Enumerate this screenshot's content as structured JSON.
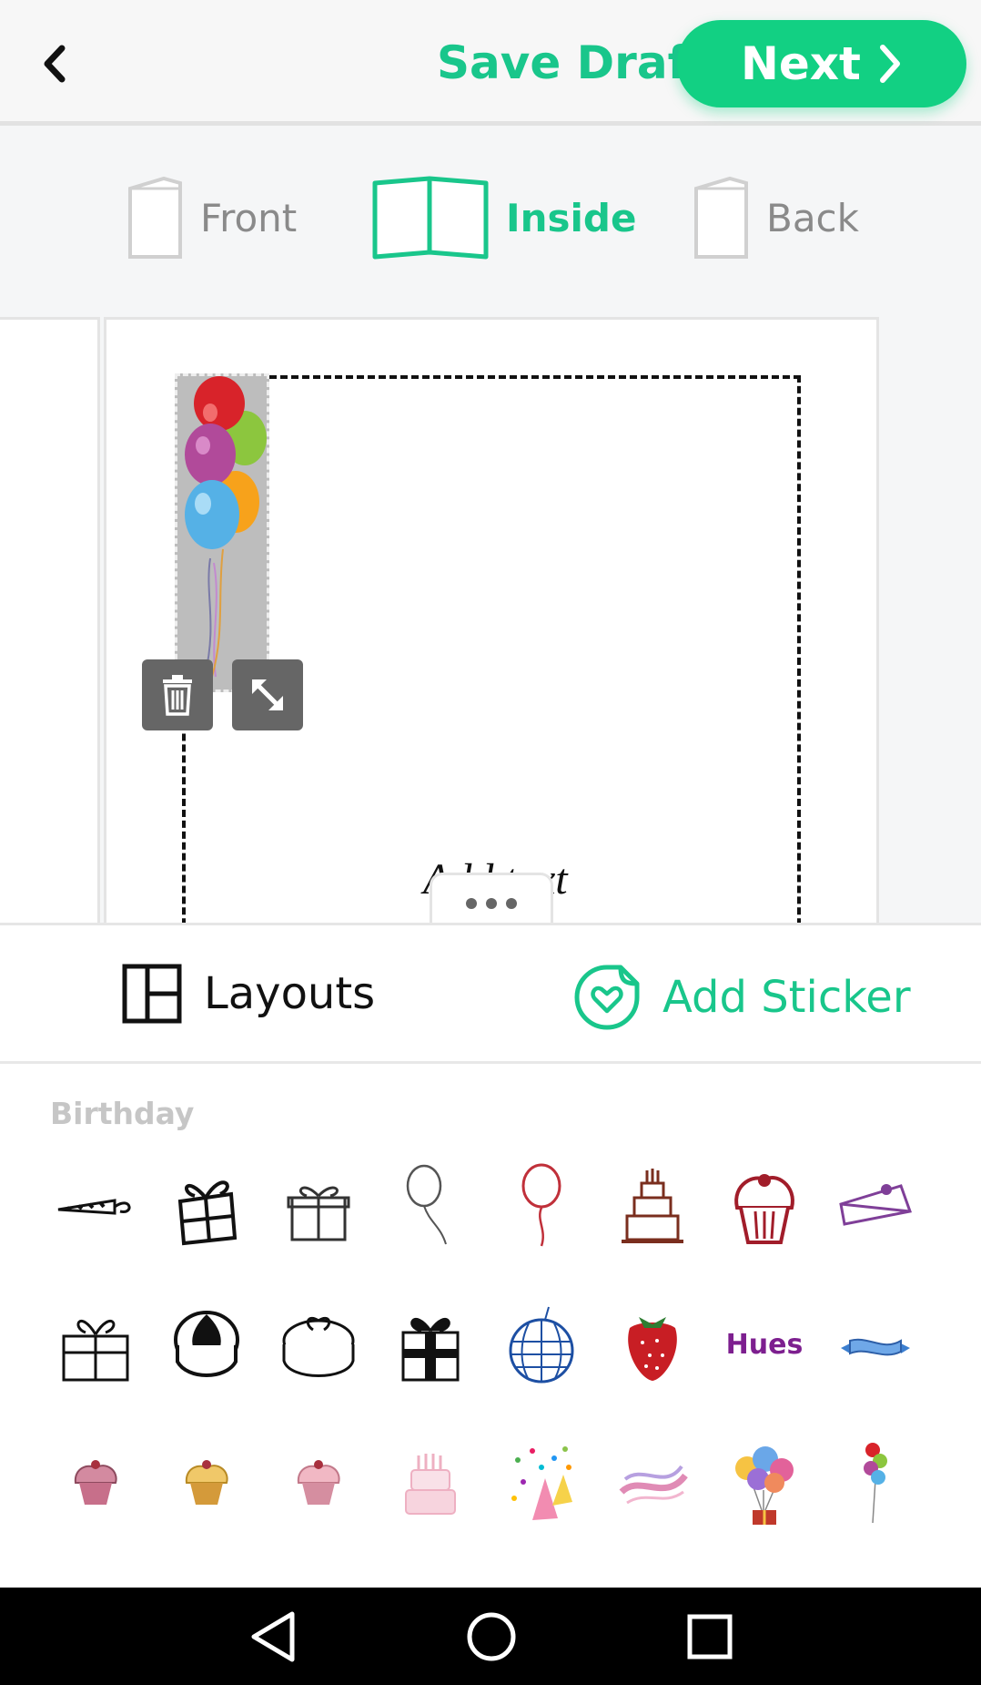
{
  "topbar": {
    "save_draft_label": "Save Draft",
    "next_label": "Next"
  },
  "tabs": [
    {
      "label": "Front",
      "active": false
    },
    {
      "label": "Inside",
      "active": true
    },
    {
      "label": "Back",
      "active": false
    }
  ],
  "canvas": {
    "placeholder_text": "Add text"
  },
  "sheet": {
    "tabs": [
      {
        "label": "Layouts",
        "active": false
      },
      {
        "label": "Add Sticker",
        "active": true
      }
    ],
    "section_title": "Birthday",
    "stickers_row2_text": "Hues"
  },
  "colors": {
    "accent": "#12d083",
    "accent_text": "#19c68b"
  }
}
